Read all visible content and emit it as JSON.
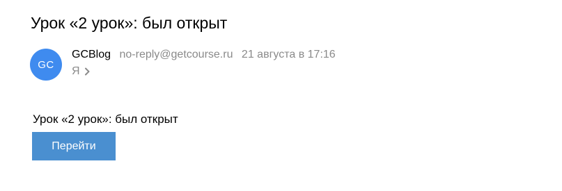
{
  "message": {
    "subject": "Урок «2 урок»: был открыт",
    "sender": {
      "avatar_initials": "GC",
      "avatar_color": "#3f8bef",
      "name": "GCBlog",
      "email": "no-reply@getcourse.ru"
    },
    "date": "21 августа в 17:16",
    "recipient": "Я",
    "recipient_icon": "chevron-right-icon",
    "body_text": "Урок «2 урок»: был открыт",
    "action_button_label": "Перейти",
    "action_button_color": "#4a8fd0"
  }
}
